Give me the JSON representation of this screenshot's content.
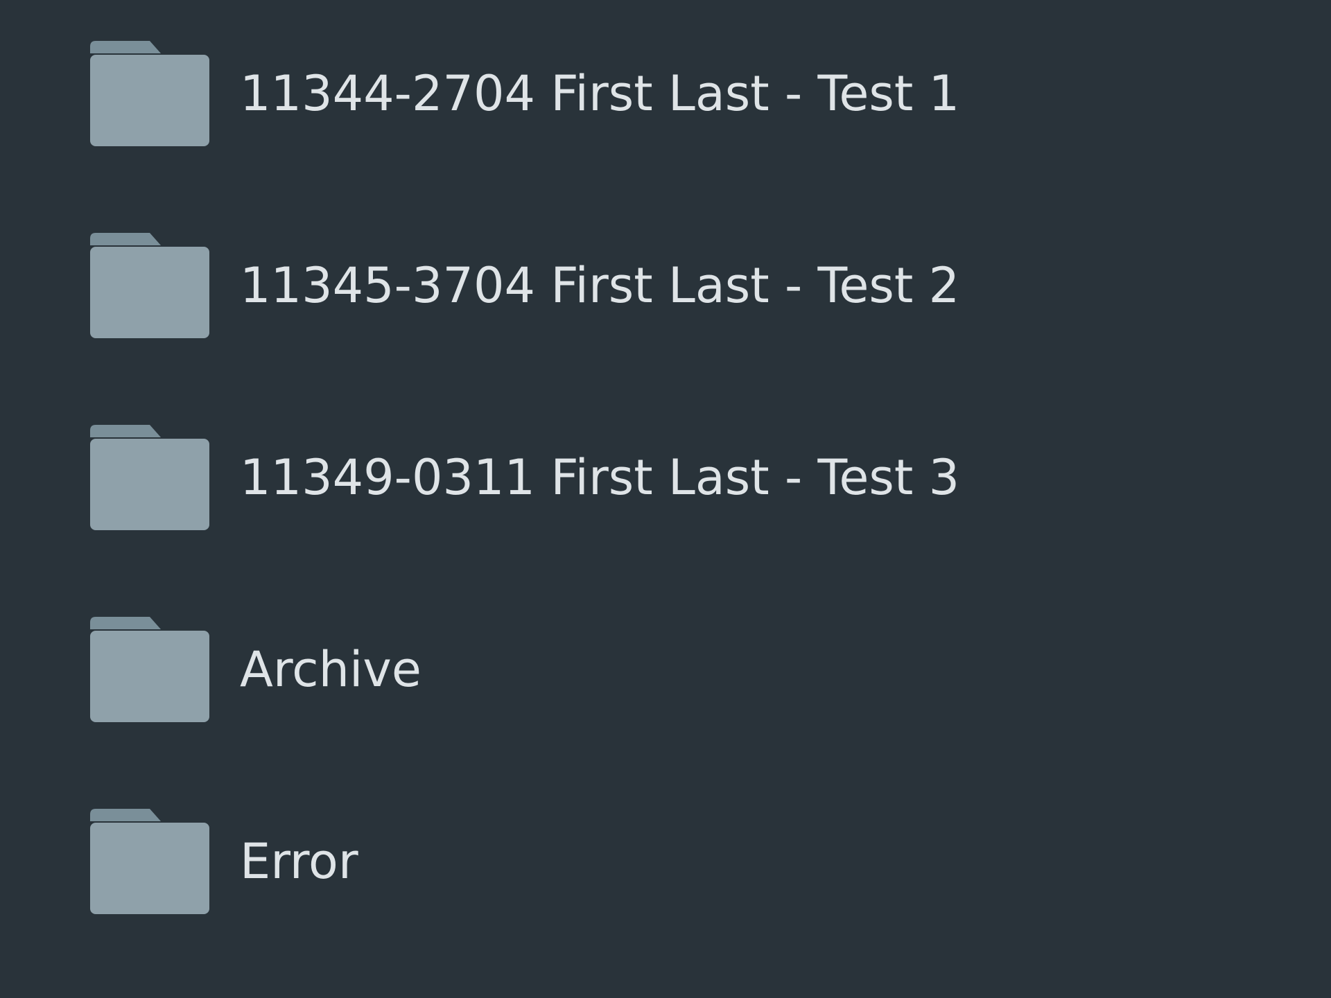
{
  "file_list": {
    "items": [
      {
        "label": "11344-2704 First Last - Test 1",
        "icon": "folder-icon"
      },
      {
        "label": "11345-3704 First Last - Test 2",
        "icon": "folder-icon"
      },
      {
        "label": "11349-0311 First Last - Test 3",
        "icon": "folder-icon"
      },
      {
        "label": "Archive",
        "icon": "folder-icon"
      },
      {
        "label": "Error",
        "icon": "folder-icon"
      }
    ]
  },
  "colors": {
    "background": "#29333a",
    "folder_body": "#8fa1aa",
    "folder_tab": "#7a8f99",
    "text": "#dfe4e7"
  }
}
